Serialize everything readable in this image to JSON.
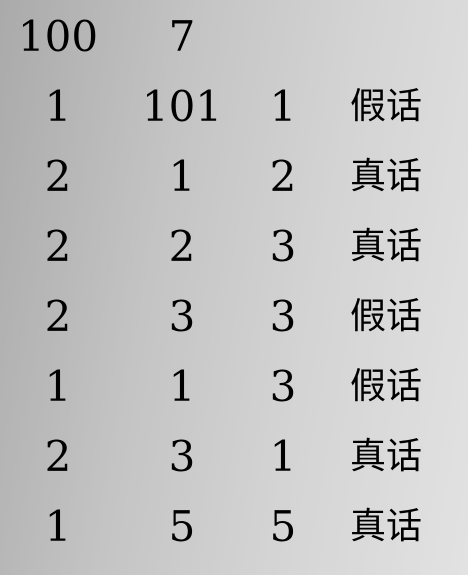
{
  "header": [
    "100",
    "7"
  ],
  "rows": [
    [
      "1",
      "101",
      "1",
      "假话"
    ],
    [
      "2",
      "1",
      "2",
      "真话"
    ],
    [
      "2",
      "2",
      "3",
      "真话"
    ],
    [
      "2",
      "3",
      "3",
      "假话"
    ],
    [
      "1",
      "1",
      "3",
      "假话"
    ],
    [
      "2",
      "3",
      "1",
      "真话"
    ],
    [
      "1",
      "5",
      "5",
      "真话"
    ]
  ]
}
